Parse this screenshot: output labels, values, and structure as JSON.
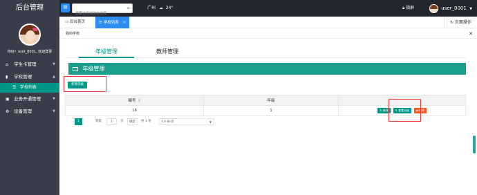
{
  "header": {
    "brand": "后台管理",
    "menu_icon": "hamburger-icon",
    "search_placeholder": "重要选择或搜索选择",
    "city": "广州",
    "temperature": "24°",
    "lock_label": "锁屏",
    "username": "user_0001"
  },
  "sidebar": {
    "welcome": "你好！user_0001, 欢迎登录",
    "items": [
      {
        "icon": "home-icon",
        "label": "学生卡管理"
      },
      {
        "icon": "bookmark-icon",
        "label": "学校管理"
      },
      {
        "icon": "list-icon",
        "label": "学校列表"
      },
      {
        "icon": "briefcase-icon",
        "label": "业务开通管理"
      },
      {
        "icon": "gears-icon",
        "label": "设备管理"
      }
    ]
  },
  "tabs": {
    "items": [
      {
        "icon": "monitor-icon",
        "label": "后台首页"
      },
      {
        "icon": "list-icon",
        "label": "学校列表"
      }
    ],
    "page_ops": "页面操作"
  },
  "breadcrumb": "我的学校",
  "subtabs": [
    "年级管理",
    "教师管理"
  ],
  "panel": {
    "title": "年级管理",
    "add_button": "新增年级"
  },
  "table": {
    "columns": [
      "编号",
      "年级",
      ""
    ],
    "rows": [
      {
        "id": "16",
        "grade": "1"
      }
    ],
    "actions": [
      "修改",
      "查看班级",
      "删除"
    ]
  },
  "pager": {
    "current": "1",
    "goto_label": "到第",
    "page_input": "1",
    "page_unit": "页",
    "confirm": "确定",
    "total": "共 1 条",
    "per_page": "10 条/页"
  },
  "colors": {
    "accent": "#009688",
    "danger": "#ff5722",
    "highlight": "#e53935",
    "primary": "#2d8cf0"
  }
}
